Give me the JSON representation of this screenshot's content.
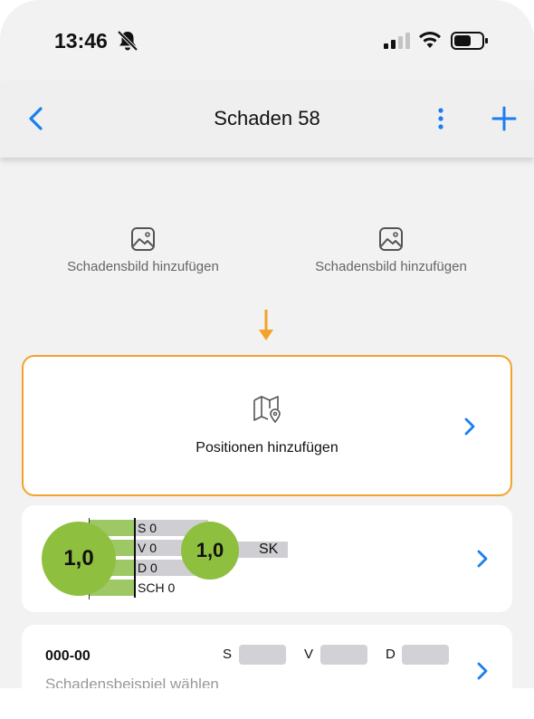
{
  "status_bar": {
    "time": "13:46",
    "icons": [
      "bell-slash-icon",
      "cellular-signal-icon",
      "wifi-icon",
      "battery-icon"
    ]
  },
  "nav": {
    "title": "Schaden 58",
    "back_icon": "chevron-left-icon",
    "more_icon": "vertical-ellipsis-icon",
    "add_icon": "plus-icon"
  },
  "photos": [
    {
      "label": "Schadensbild hinzufügen",
      "icon": "image-icon"
    },
    {
      "label": "Schadensbild hinzufügen",
      "icon": "image-icon"
    }
  ],
  "positions_card": {
    "label": "Positionen hinzufügen",
    "icon": "map-pin-icon"
  },
  "rating_card": {
    "main_score": "1,0",
    "secondary_score": "1,0",
    "rows": [
      {
        "label": "S 0"
      },
      {
        "label": "V 0"
      },
      {
        "label": "D 0"
      },
      {
        "label": "SCH 0"
      }
    ],
    "secondary_label": "SK"
  },
  "example_card": {
    "code": "000-00",
    "fields": [
      {
        "letter": "S"
      },
      {
        "letter": "V"
      },
      {
        "letter": "D"
      }
    ],
    "hint": "Schadensbeispiel wählen"
  },
  "colors": {
    "accent": "#1a7ef0",
    "highlight": "#f3a32a",
    "score_green": "#8fbf3f",
    "bar_green": "#9ec865",
    "bar_gray": "#cfcfd3"
  }
}
